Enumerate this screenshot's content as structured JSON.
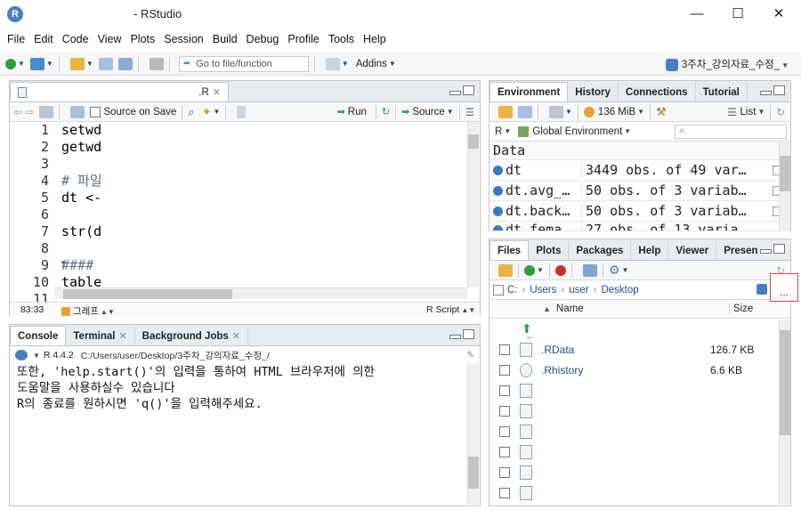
{
  "window": {
    "app_icon_letter": "R",
    "title": "- RStudio",
    "minimize": "—",
    "maximize": "☐",
    "close": "✕"
  },
  "menu": [
    "File",
    "Edit",
    "Code",
    "View",
    "Plots",
    "Session",
    "Build",
    "Debug",
    "Profile",
    "Tools",
    "Help"
  ],
  "toolbar": {
    "goto_placeholder": "Go to file/function",
    "addins_label": "Addins",
    "project_label": "3주차_강의자료_수정_"
  },
  "editor": {
    "tab_label": ".R",
    "source_on_save": "Source on Save",
    "run_label": "Run",
    "source_label": "Source",
    "line_numbers": [
      "1",
      "2",
      "3",
      "4",
      "5",
      "6",
      "7",
      "8",
      "9",
      "10",
      "11"
    ],
    "lines": [
      "setwd",
      "getwd",
      "",
      "# 파일",
      "dt <-",
      "",
      "str(d",
      "",
      "####",
      "table",
      ""
    ],
    "status_position": "83:33",
    "status_section": "그래프",
    "status_type": "R Script"
  },
  "console": {
    "tabs": [
      "Console",
      "Terminal",
      "Background Jobs"
    ],
    "r_version": "R 4.4.2",
    "path": "C:/Users/user/Desktop/3주차_강의자료_수정_/",
    "lines": [
      "또한, 'help.start()'의 입력을 통하여 HTML 브라우저에 의한",
      "도움말을 사용하실수 있습니다",
      "R의 종료를 원하시면 'q()'을 입력해주세요."
    ]
  },
  "environment": {
    "tabs": [
      "Environment",
      "History",
      "Connections",
      "Tutorial"
    ],
    "memory": "136 MiB",
    "list_label": "List",
    "language": "R",
    "scope": "Global Environment",
    "section": "Data",
    "rows": [
      {
        "name": "dt",
        "value": "3449 obs. of 49 var…"
      },
      {
        "name": "dt.avg_…",
        "value": "50 obs. of 3 variab…"
      },
      {
        "name": "dt.back…",
        "value": "50 obs. of 3 variab…"
      },
      {
        "name": "dt.fema…",
        "value": "27 obs. of 13 varia…"
      }
    ]
  },
  "files": {
    "tabs": [
      "Files",
      "Plots",
      "Packages",
      "Help",
      "Viewer",
      "Presen"
    ],
    "breadcrumb": [
      "C:",
      "Users",
      "user",
      "Desktop"
    ],
    "more_label": "...",
    "col_name": "Name",
    "col_size": "Size",
    "up_label": "..",
    "rows": [
      {
        "name": ".RData",
        "size": "126.7 KB"
      },
      {
        "name": ".Rhistory",
        "size": "6.6 KB"
      },
      {
        "name": "",
        "size": ""
      },
      {
        "name": "",
        "size": ""
      },
      {
        "name": "",
        "size": ""
      },
      {
        "name": "",
        "size": ""
      },
      {
        "name": "",
        "size": ""
      },
      {
        "name": "",
        "size": ""
      }
    ]
  },
  "colors": {
    "accent_red": "#e0454b",
    "link_blue": "#1a4f8a",
    "pane_bg": "#e8ecef"
  }
}
